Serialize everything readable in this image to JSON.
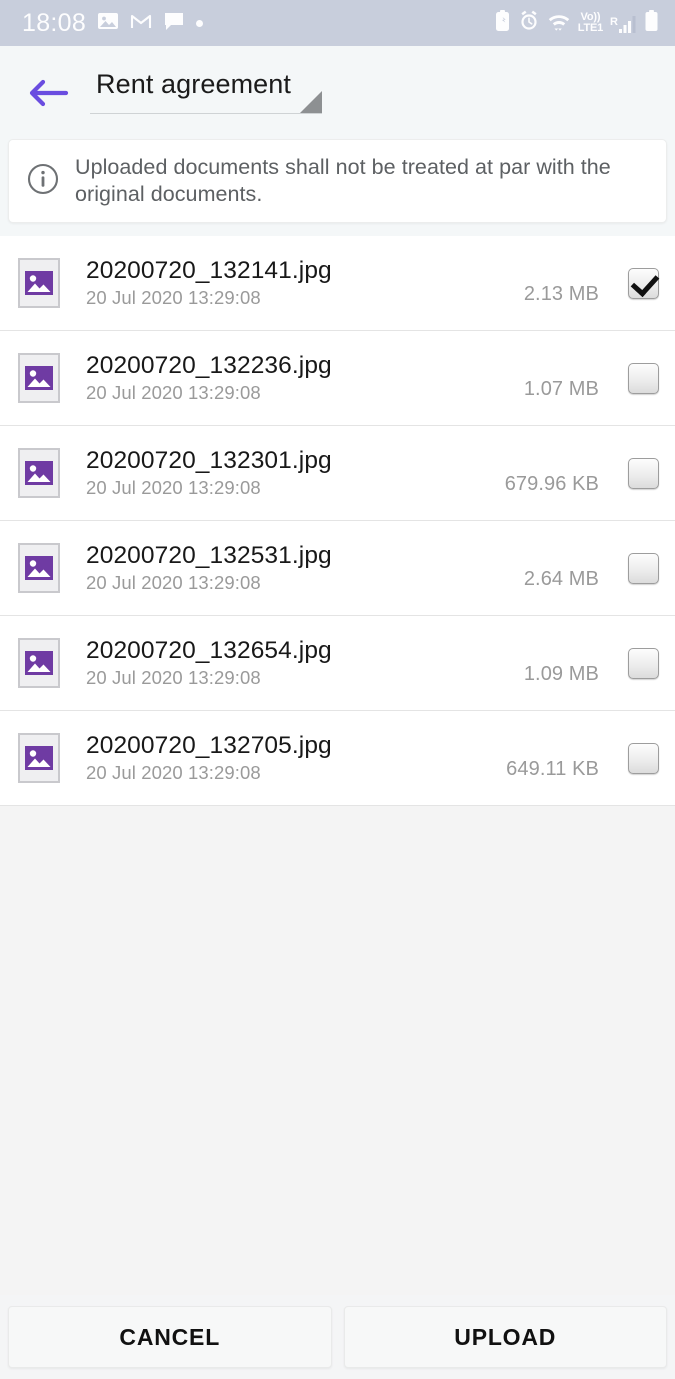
{
  "statusbar": {
    "time": "18:08",
    "left_icons": [
      "photos-icon",
      "gmail-icon",
      "messages-icon",
      "dot-indicator"
    ],
    "volte_label_top": "Vo))",
    "volte_label_bottom": "LTE1",
    "roaming_label": "R",
    "right_icons": [
      "battery-saver-icon",
      "alarm-icon",
      "wifi-icon",
      "volte-icon",
      "signal-icon",
      "battery-icon"
    ],
    "bg_color": "#c8cedc"
  },
  "appbar": {
    "back_label": "back-arrow",
    "title": "Rent agreement",
    "accent_color": "#6a4de0"
  },
  "banner": {
    "icon": "info-icon",
    "text": "Uploaded documents shall not be treated at par with the original documents."
  },
  "files": [
    {
      "name": "20200720_132141.jpg",
      "date": "20 Jul 2020 13:29:08",
      "size": "2.13 MB",
      "checked": true
    },
    {
      "name": "20200720_132236.jpg",
      "date": "20 Jul 2020 13:29:08",
      "size": "1.07 MB",
      "checked": false
    },
    {
      "name": "20200720_132301.jpg",
      "date": "20 Jul 2020 13:29:08",
      "size": "679.96 KB",
      "checked": false
    },
    {
      "name": "20200720_132531.jpg",
      "date": "20 Jul 2020 13:29:08",
      "size": "2.64 MB",
      "checked": false
    },
    {
      "name": "20200720_132654.jpg",
      "date": "20 Jul 2020 13:29:08",
      "size": "1.09 MB",
      "checked": false
    },
    {
      "name": "20200720_132705.jpg",
      "date": "20 Jul 2020 13:29:08",
      "size": "649.11 KB",
      "checked": false
    }
  ],
  "bottombar": {
    "cancel_label": "CANCEL",
    "upload_label": "UPLOAD"
  },
  "colors": {
    "thumbnail_purple": "#6f3ba3",
    "accent": "#6a4de0",
    "page_bg": "#f4f4f4"
  }
}
